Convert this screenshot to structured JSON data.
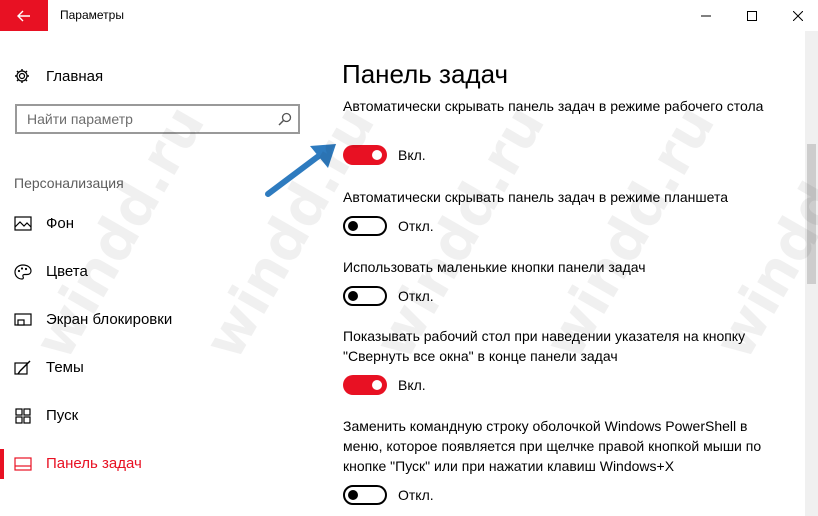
{
  "window": {
    "title": "Параметры",
    "controls": {
      "minimize": "minimize-icon",
      "maximize": "maximize-icon",
      "close": "close-icon"
    }
  },
  "sidebar": {
    "home_label": "Главная",
    "search": {
      "placeholder": "Найти параметр",
      "value": ""
    },
    "section_header": "Персонализация",
    "items": [
      {
        "label": "Фон",
        "icon": "picture-icon",
        "active": false
      },
      {
        "label": "Цвета",
        "icon": "palette-icon",
        "active": false
      },
      {
        "label": "Экран блокировки",
        "icon": "lock-screen-icon",
        "active": false
      },
      {
        "label": "Темы",
        "icon": "themes-icon",
        "active": false
      },
      {
        "label": "Пуск",
        "icon": "start-icon",
        "active": false
      },
      {
        "label": "Панель задач",
        "icon": "taskbar-icon",
        "active": true
      }
    ]
  },
  "main": {
    "title": "Панель задач",
    "settings": [
      {
        "text": "Автоматически скрывать панель задач в режиме рабочего стола",
        "state": "Вкл.",
        "on": true
      },
      {
        "text": "Автоматически скрывать панель задач в режиме планшета",
        "state": "Откл.",
        "on": false
      },
      {
        "text": "Использовать маленькие кнопки панели задач",
        "state": "Откл.",
        "on": false
      },
      {
        "text": "Показывать рабочий стол при наведении указателя на кнопку \"Свернуть все окна\" в конце панели задач",
        "state": "Вкл.",
        "on": true
      },
      {
        "text": "Заменить командную строку оболочкой Windows PowerShell в меню, которое появляется при щелчке правой кнопкой мыши по кнопке \"Пуск\" или при нажатии клавиш Windows+X",
        "state": "Откл.",
        "on": false
      }
    ]
  },
  "watermark": "windd.ru",
  "colors": {
    "accent": "#e81123",
    "annotation_arrow": "#2e7bbf"
  }
}
